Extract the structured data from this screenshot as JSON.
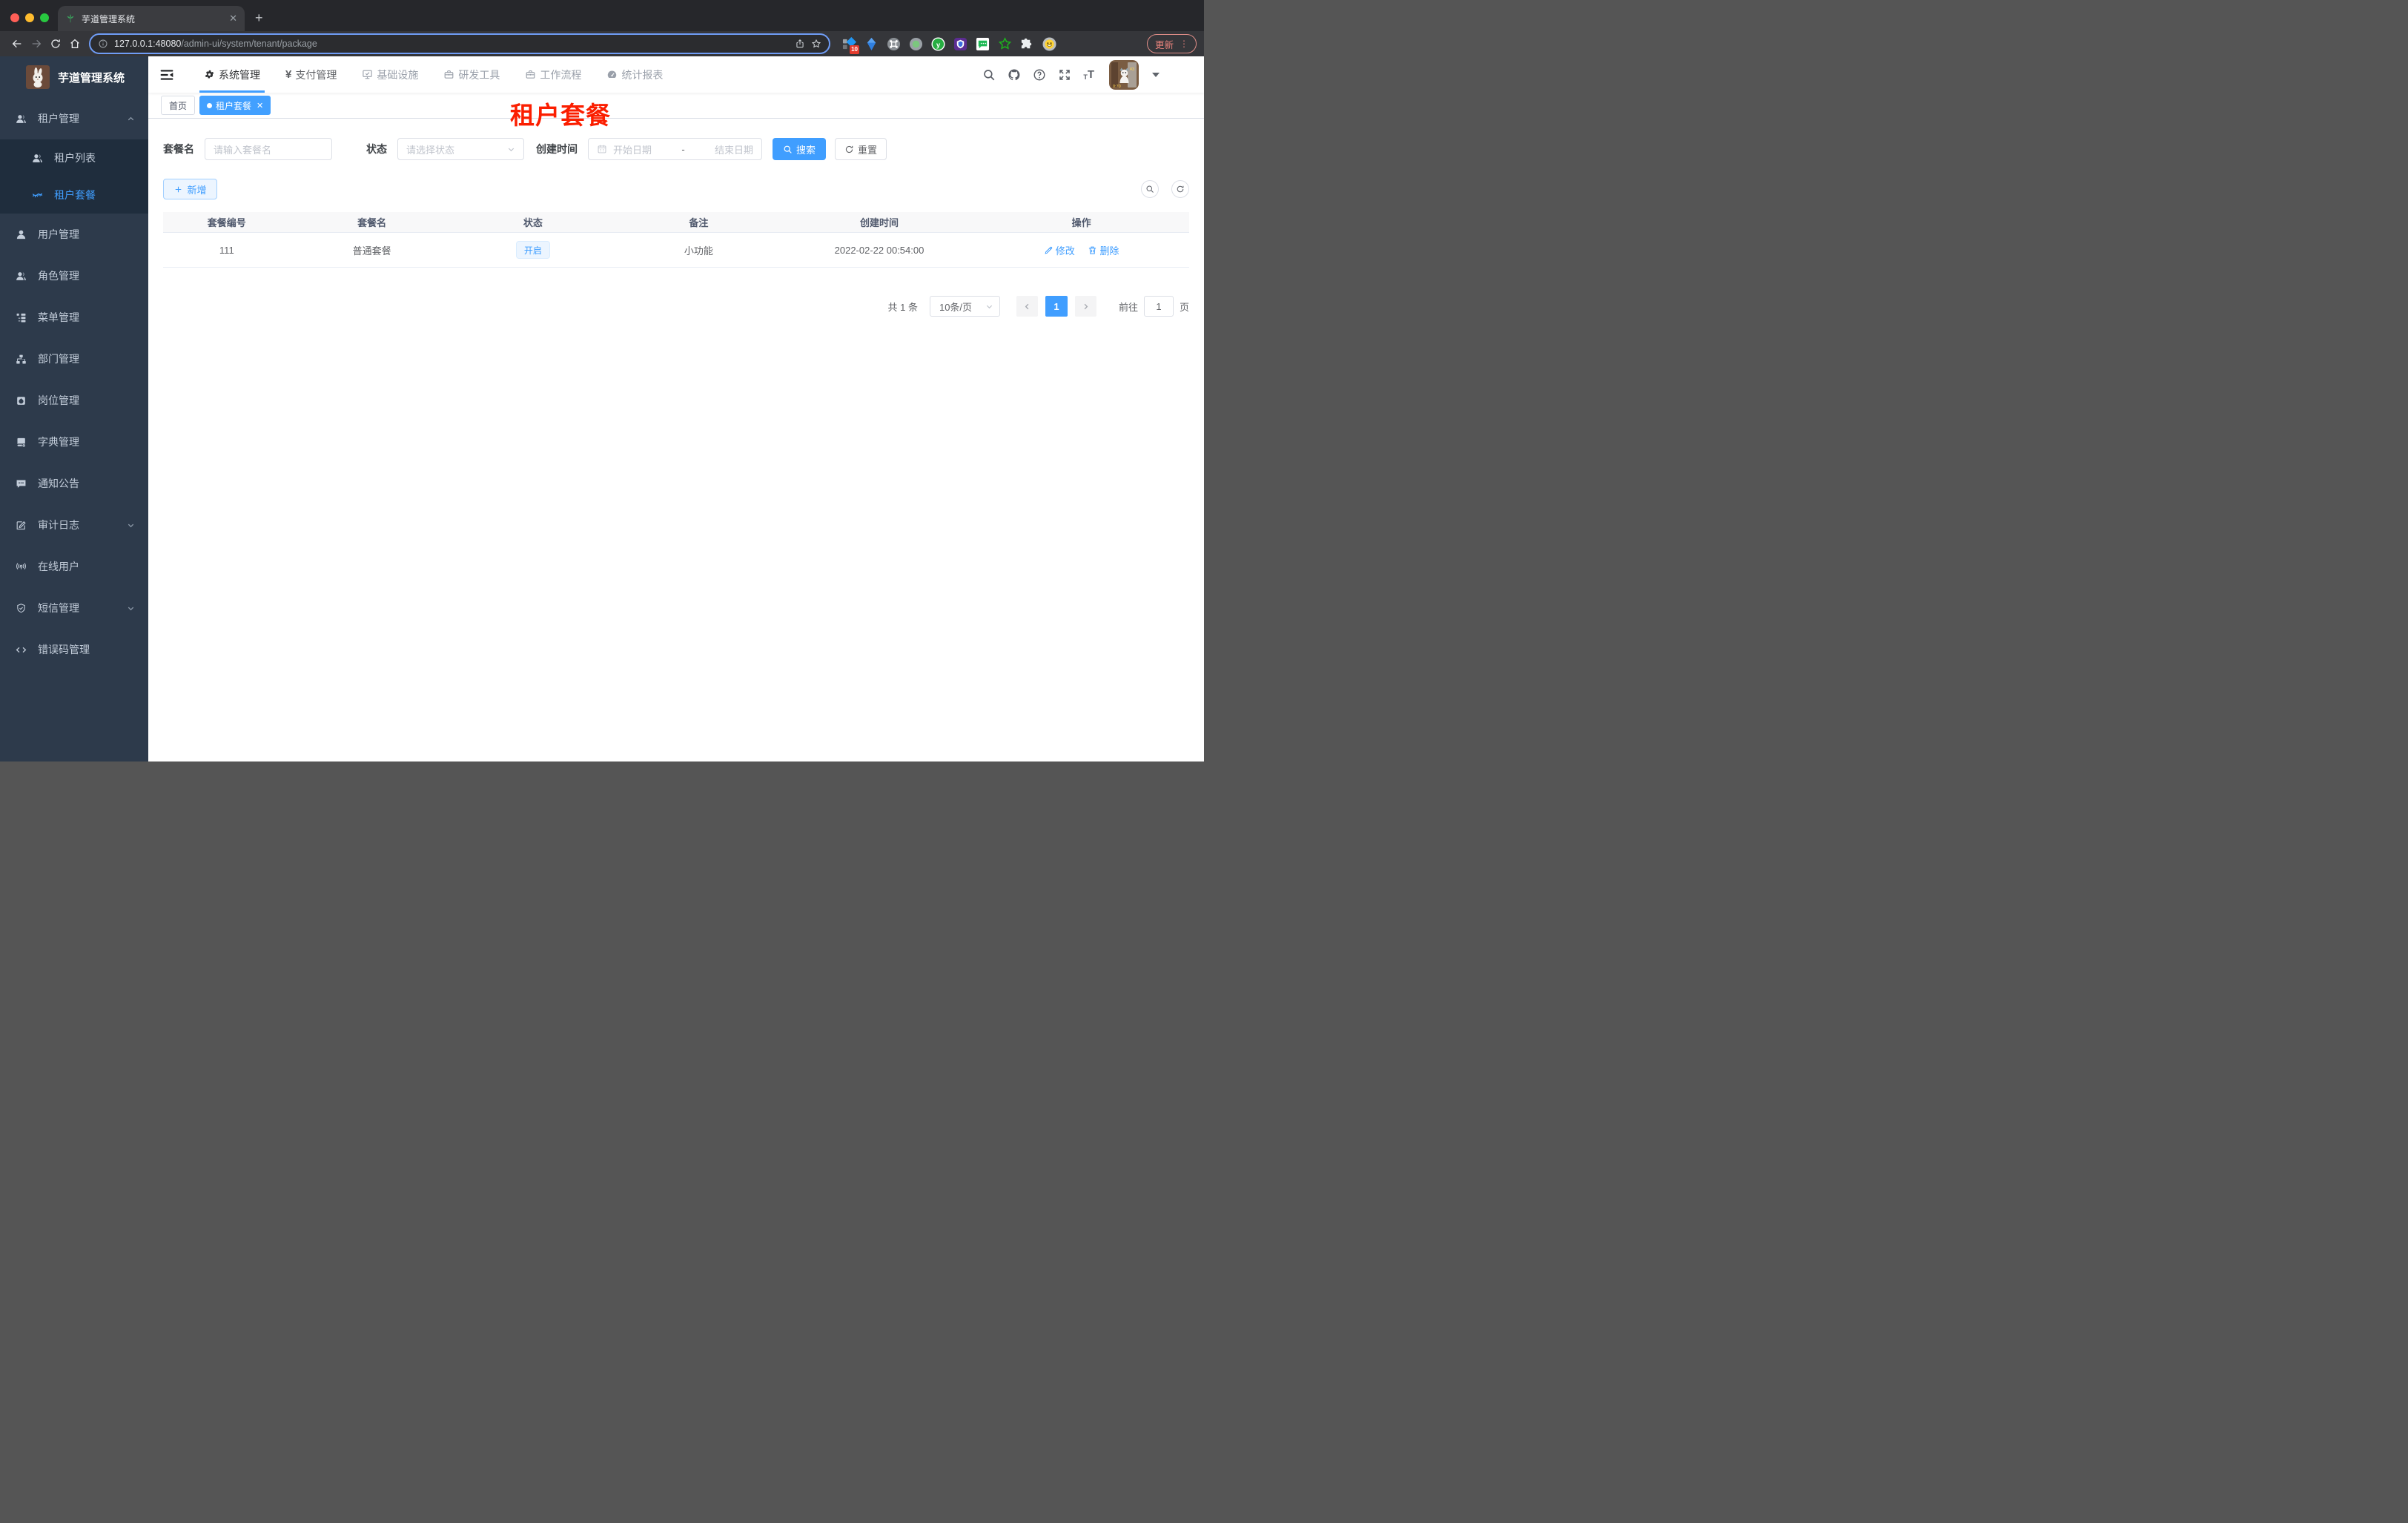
{
  "colors": {
    "accent": "#409eff",
    "red_title": "#fb1e00",
    "sidebar_bg": "#2d3a4b",
    "sidebar_submenu_bg": "#1f2d3d",
    "status_tag_bg": "#ecf5ff"
  },
  "icons": {
    "favicon": "green-leaf",
    "logo": "rabbit",
    "avatar": "cat-photo",
    "search": "magnifier",
    "github": "octocat",
    "help": "question-circle",
    "fullscreen": "expand-arrows",
    "font_size": "TT",
    "hamburger": "menu-fold-arrow",
    "active_menu_icon": "closed-eye-lashes"
  },
  "browser": {
    "tab_title": "芋道管理系统",
    "new_tab": "+",
    "tab_close": "✕",
    "url": {
      "host": "127.0.0.1:48080",
      "path": "/admin-ui/system/tenant/package"
    },
    "extension_badge": "10",
    "update_label": "更新",
    "menu_dots": "⋮"
  },
  "sidebar": {
    "logo_title": "芋道管理系统",
    "items": [
      {
        "label": "租户管理"
      },
      {
        "label": "租户列表"
      },
      {
        "label": "租户套餐"
      },
      {
        "label": "用户管理"
      },
      {
        "label": "角色管理"
      },
      {
        "label": "菜单管理"
      },
      {
        "label": "部门管理"
      },
      {
        "label": "岗位管理"
      },
      {
        "label": "字典管理"
      },
      {
        "label": "通知公告"
      },
      {
        "label": "审计日志"
      },
      {
        "label": "在线用户"
      },
      {
        "label": "短信管理"
      },
      {
        "label": "错误码管理"
      }
    ]
  },
  "topnav": {
    "items": [
      {
        "label": "系统管理"
      },
      {
        "label": "支付管理"
      },
      {
        "label": "基础设施"
      },
      {
        "label": "研发工具"
      },
      {
        "label": "工作流程"
      },
      {
        "label": "统计报表"
      }
    ]
  },
  "tags": {
    "items": [
      {
        "label": "首页"
      },
      {
        "label": "租户套餐"
      }
    ]
  },
  "page": {
    "red_title": "租户套餐"
  },
  "filters": {
    "name_label": "套餐名",
    "name_placeholder": "请输入套餐名",
    "status_label": "状态",
    "status_placeholder": "请选择状态",
    "date_label": "创建时间",
    "date_start_placeholder": "开始日期",
    "date_separator": "-",
    "date_end_placeholder": "结束日期",
    "search_label": "搜索",
    "reset_label": "重置"
  },
  "toolbar": {
    "add_label": "新增"
  },
  "table": {
    "columns": [
      "套餐编号",
      "套餐名",
      "状态",
      "备注",
      "创建时间",
      "操作"
    ],
    "rows": [
      {
        "id": "111",
        "name": "普通套餐",
        "status": "开启",
        "remark": "小功能",
        "create_time": "2022-02-22 00:54:00",
        "edit": "修改",
        "delete": "删除"
      }
    ]
  },
  "pagination": {
    "total": "共 1 条",
    "page_size": "10条/页",
    "current_page": "1",
    "goto_label": "前往",
    "goto_value": "1",
    "page_unit": "页"
  }
}
